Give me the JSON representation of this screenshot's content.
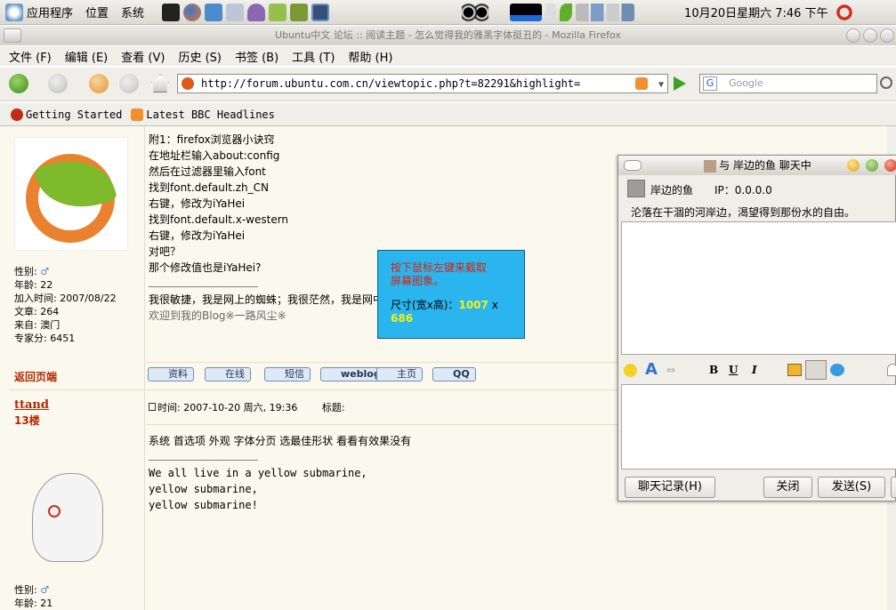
{
  "topbar": {
    "menus": [
      "应用程序",
      "位置",
      "系统"
    ],
    "clock": "10月20日星期六 7:46 下午"
  },
  "window": {
    "title": "Ubuntu中文 论坛 :: 阅读主题 - 怎么觉得我的雅黑字体挺丑的 - Mozilla Firefox"
  },
  "menubar": [
    "文件 (F)",
    "编辑 (E)",
    "查看 (V)",
    "历史 (S)",
    "书签 (B)",
    "工具 (T)",
    "帮助 (H)"
  ],
  "nav": {
    "url": "http://forum.ubuntu.com.cn/viewtopic.php?t=82291&highlight=",
    "search_placeholder": "Google"
  },
  "bookmarks": [
    "Getting Started",
    "Latest BBC Headlines"
  ],
  "post1": {
    "profile": [
      "性别:",
      "年龄: 22",
      "加入时间: 2007/08/22",
      "文章: 264",
      "来自: 澳门",
      "专家分: 6451"
    ],
    "lines": [
      "附1：firefox浏览器小诀窍",
      "在地址栏输入about:config",
      "然后在过滤器里输入font",
      "找到font.default.zh_CN",
      "右键，修改为iYaHei",
      "找到font.default.x-western",
      "右键，修改为iYaHei",
      "对吧？",
      "那个修改值也是iYaHei?"
    ],
    "divider": "_________________",
    "sig1": "我很敏捷，我是网上的蜘蛛；我很茫然，我是网中",
    "sig2": "欢迎到我的Blog※一路风尘※",
    "back_to_top": "返回页端",
    "buttons": [
      "资料",
      "在线",
      "短信",
      "weblog",
      "主页",
      "QQ"
    ]
  },
  "post2": {
    "username": "ttand",
    "floor": "13楼",
    "time": "时间: 2007-10-20 周六, 19:36",
    "subject_label": "标题:",
    "line1": "系统 首选项 外观 字体分页 选最佳形状 看看有效果没有",
    "divider": "_________________",
    "sig_lines": [
      "We all live in a yellow submarine,",
      "yellow submarine,",
      "yellow submarine!"
    ],
    "profile": [
      "性别:",
      "年龄: 21"
    ]
  },
  "tooltip": {
    "line1": "按下鼠标左键来截取",
    "line2": "屏幕图象。",
    "size_label": "尺寸(宽x高)：",
    "size_w": "1007",
    "size_x": " x",
    "size_h": "686"
  },
  "chat": {
    "title": "与 岸边的鱼 聊天中",
    "contact": "岸边的鱼",
    "ip": "IP：0.0.0.0",
    "status": "沦落在干涸的河岸边，渴望得到那份水的自由。",
    "history_btn": "聊天记录(H)",
    "close_btn": "关闭",
    "send_btn": "发送(S)",
    "fmt_bold": "B",
    "fmt_underline": "U",
    "fmt_italic": "I"
  },
  "colors": {
    "link_red": "#b22a00",
    "tooltip_bg": "#2bb5ee",
    "tooltip_red": "#d8220f",
    "tooltip_yellow": "#f3f30b"
  }
}
